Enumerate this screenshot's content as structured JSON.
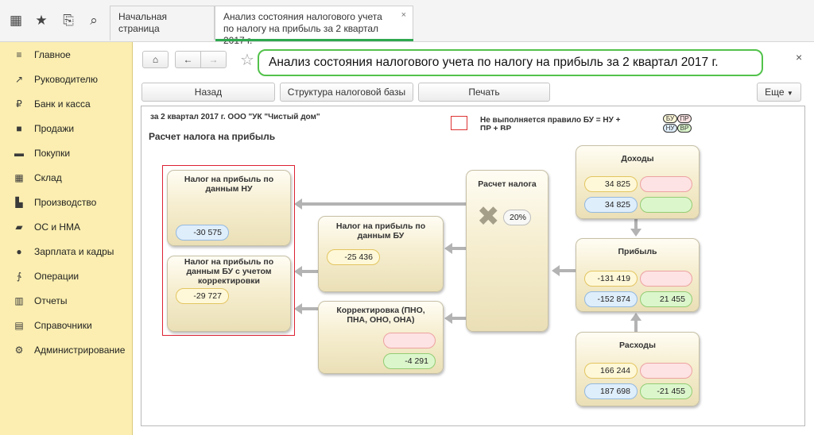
{
  "topbar": {
    "tabs": [
      {
        "label": "Начальная страница"
      },
      {
        "label": "Анализ состояния налогового учета по налогу на прибыль за 2 квартал 2017 г.",
        "close": "×"
      }
    ]
  },
  "sidebar": {
    "items": [
      {
        "label": "Главное",
        "icon": "menu-icon"
      },
      {
        "label": "Руководителю",
        "icon": "chart-line-icon"
      },
      {
        "label": "Банк и касса",
        "icon": "ruble-icon"
      },
      {
        "label": "Продажи",
        "icon": "shopping-bag-icon"
      },
      {
        "label": "Покупки",
        "icon": "cart-icon"
      },
      {
        "label": "Склад",
        "icon": "grid-icon"
      },
      {
        "label": "Производство",
        "icon": "factory-icon"
      },
      {
        "label": "ОС и НМА",
        "icon": "truck-icon"
      },
      {
        "label": "Зарплата и кадры",
        "icon": "person-icon"
      },
      {
        "label": "Операции",
        "icon": "operations-icon"
      },
      {
        "label": "Отчеты",
        "icon": "bar-chart-icon"
      },
      {
        "label": "Справочники",
        "icon": "books-icon"
      },
      {
        "label": "Администрирование",
        "icon": "gear-icon"
      }
    ]
  },
  "header": {
    "title": "Анализ состояния налогового учета по налогу на прибыль за 2 квартал 2017 г.",
    "close": "×"
  },
  "toolbar": {
    "back": "Назад",
    "structure": "Структура налоговой базы",
    "print": "Печать",
    "more": "Еще"
  },
  "report": {
    "period": "за 2 квартал 2017 г. ООО \"УК \"Чистый дом\"",
    "section": "Расчет налога на прибыль",
    "rule_text": "Не выполняется правило БУ = НУ + ПР + ВР",
    "legend": {
      "bu": "БУ",
      "pr": "ПР",
      "nu": "НУ",
      "vr": "ВР"
    }
  },
  "cards": {
    "income": {
      "title": "Доходы",
      "bu": "34 825",
      "nu": "34 825",
      "pr": "",
      "vr": ""
    },
    "profit": {
      "title": "Прибыль",
      "bu": "-131 419",
      "nu": "-152 874",
      "pr": "",
      "vr": "21 455"
    },
    "expenses": {
      "title": "Расходы",
      "bu": "166 244",
      "nu": "187 698",
      "pr": "",
      "vr": "-21 455"
    },
    "calc": {
      "title": "Расчет налога",
      "rate": "20%"
    },
    "tax_nu": {
      "title": "Налог на прибыль по данным НУ",
      "value": "-30 575"
    },
    "tax_bu": {
      "title": "Налог на прибыль по данным БУ",
      "value": "-25 436"
    },
    "tax_adj": {
      "title": "Налог на прибыль по данным БУ с учетом корректировки",
      "value": "-29 727"
    },
    "correction": {
      "title": "Корректировка (ПНО, ПНА, ОНО, ОНА)",
      "pr": "",
      "vr": "-4 291"
    }
  }
}
